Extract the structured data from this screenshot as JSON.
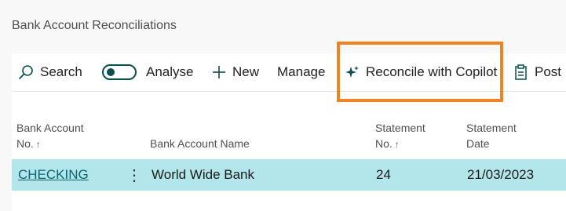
{
  "page": {
    "title": "Bank Account Reconciliations"
  },
  "toolbar": {
    "search_label": "Search",
    "analyse_label": "Analyse",
    "new_label": "New",
    "manage_label": "Manage",
    "copilot_label": "Reconcile with Copilot",
    "post_label": "Post"
  },
  "table": {
    "columns": {
      "bank_account_no_line1": "Bank Account",
      "bank_account_no_line2": "No.",
      "bank_account_name": "Bank Account Name",
      "statement_no_line1": "Statement",
      "statement_no_line2": "No.",
      "statement_date_line1": "Statement",
      "statement_date_line2": "Date",
      "sort_arrow": "↑"
    },
    "rows": [
      {
        "bank_account_no": "CHECKING",
        "menu": "⋮",
        "bank_account_name": "World Wide Bank",
        "statement_no": "24",
        "statement_date": "21/03/2023"
      }
    ]
  },
  "colors": {
    "highlight": "#f58220",
    "selected_row": "#b3e6ea",
    "accent": "#0b4f4f"
  }
}
